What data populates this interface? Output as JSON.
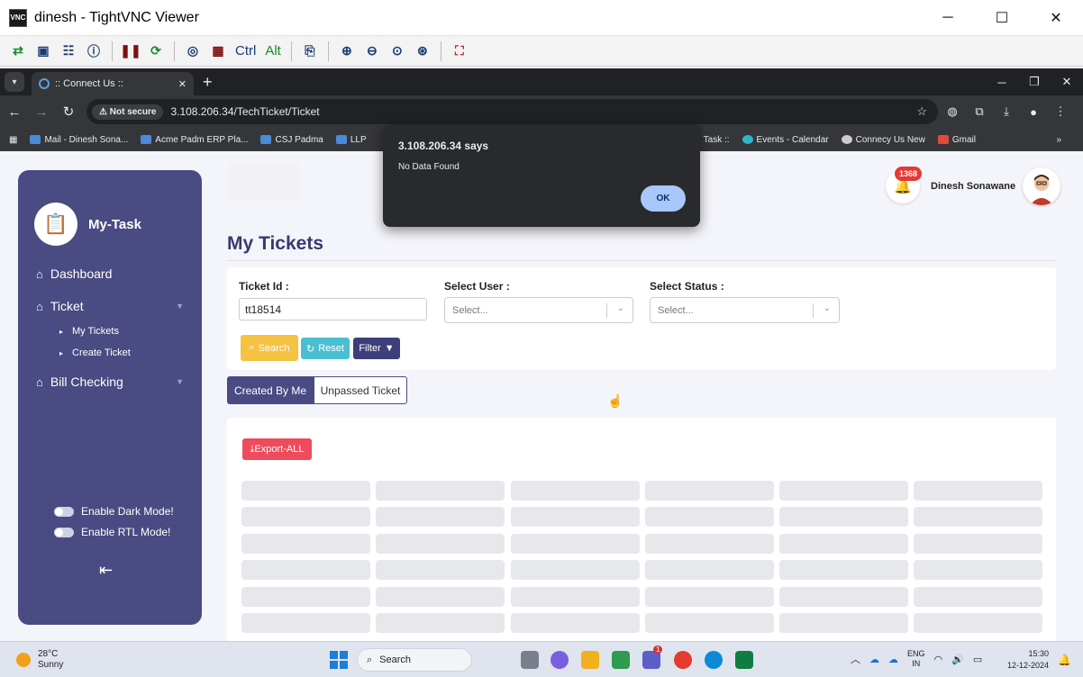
{
  "vnc": {
    "title": "dinesh - TightVNC Viewer",
    "toolbar_text": {
      "ctrl": "Ctrl",
      "alt": "Alt"
    }
  },
  "browser": {
    "tab_title": ":: Connect Us ::",
    "security_label": "Not secure",
    "url": "3.108.206.34/TechTicket/Ticket",
    "bookmarks": [
      "Mail - Dinesh Sona...",
      "Acme Padm ERP Pla...",
      "CSJ Padma",
      "LLP",
      "Task ::",
      "Events - Calendar",
      "Connecy Us New",
      "Gmail"
    ]
  },
  "sidebar": {
    "brand": "My-Task",
    "items": {
      "dashboard": "Dashboard",
      "ticket": "Ticket",
      "my_tickets": "My Tickets",
      "create_ticket": "Create Ticket",
      "bill_checking": "Bill Checking"
    },
    "dark_mode_label": "Enable Dark Mode!",
    "rtl_mode_label": "Enable RTL Mode!"
  },
  "header": {
    "notification_count": "1368",
    "user_name": "Dinesh Sonawane"
  },
  "main": {
    "title": "My Tickets",
    "filters": {
      "ticket_id_label": "Ticket Id :",
      "ticket_id_value": "tt18514",
      "user_label": "Select User :",
      "user_placeholder": "Select...",
      "status_label": "Select Status :",
      "status_placeholder": "Select..."
    },
    "buttons": {
      "search": "Search",
      "reset": "Reset",
      "filter": "Filter"
    },
    "tabs": {
      "created_by_me": "Created By Me",
      "unpassed_ticket": "Unpassed Ticket"
    },
    "export_label": "Export-ALL"
  },
  "alert": {
    "heading": "3.108.206.34 says",
    "message": "No Data Found",
    "ok_label": "OK"
  },
  "taskbar": {
    "temperature": "28°C",
    "weather": "Sunny",
    "search_label": "Search",
    "lang_1": "ENG",
    "lang_2": "IN",
    "time": "15:30",
    "date": "12-12-2024",
    "teams_badge": "1"
  },
  "colors": {
    "sidebar": "#4a4b82",
    "search_button": "#f5c242",
    "reset_button": "#4bbfd1",
    "export_button": "#ee4b5c",
    "badge": "#e53935"
  }
}
